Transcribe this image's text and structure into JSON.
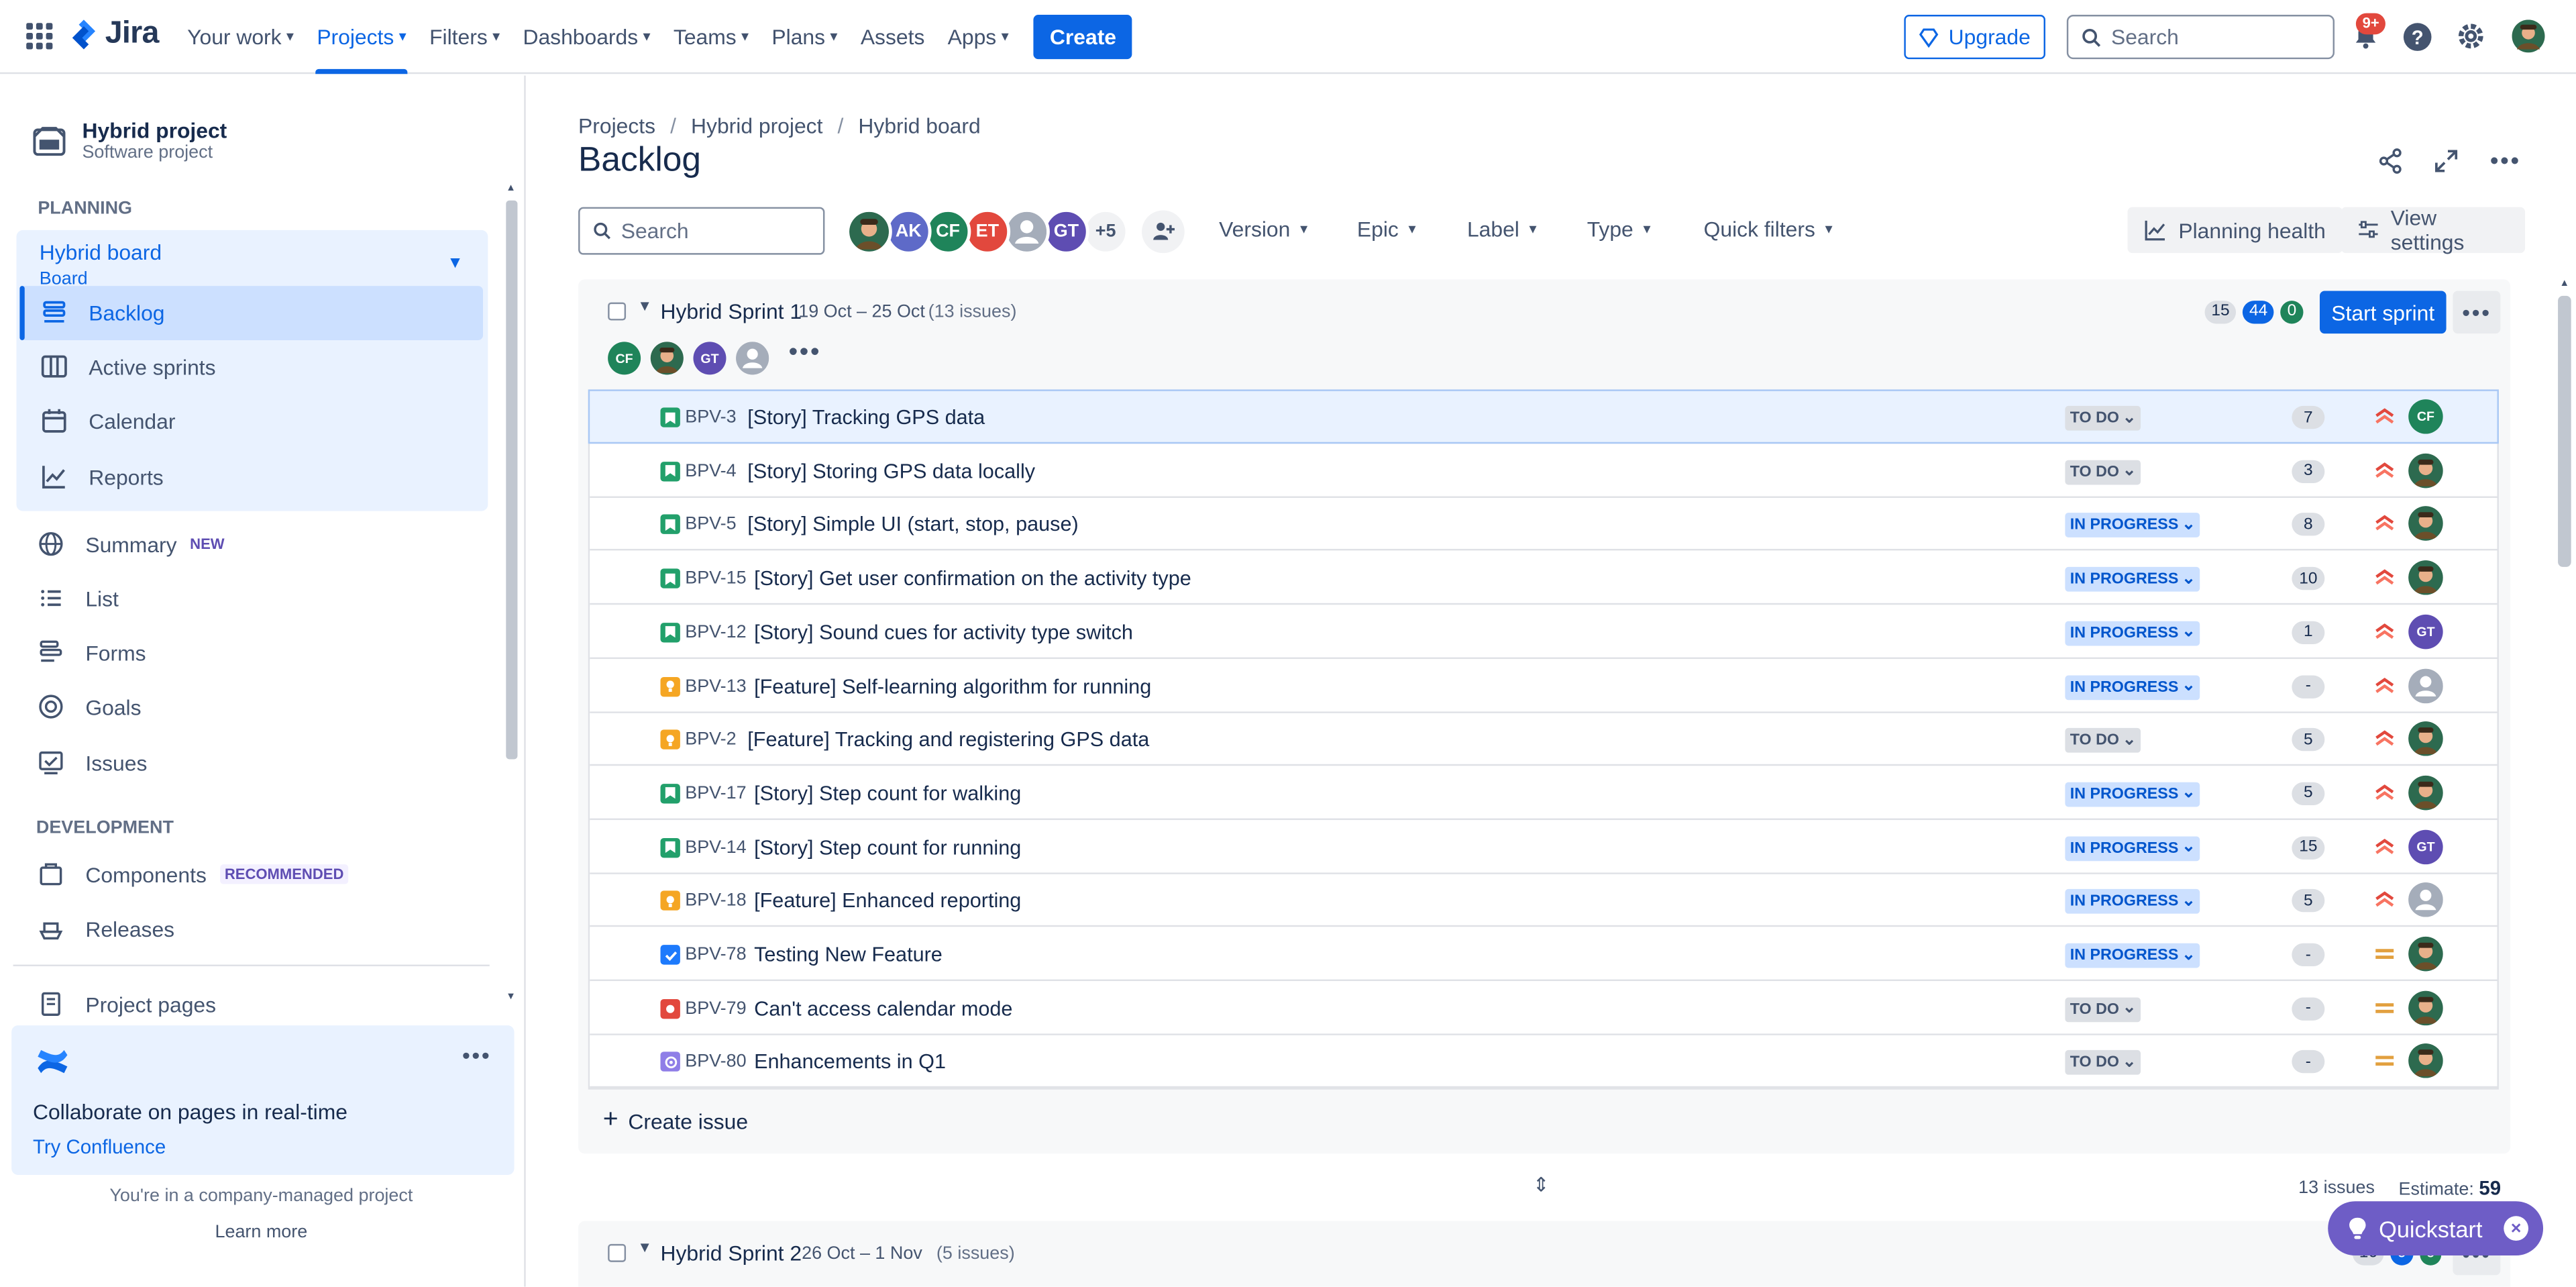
{
  "topnav": {
    "logo": "Jira",
    "links": [
      "Your work",
      "Projects",
      "Filters",
      "Dashboards",
      "Teams",
      "Plans",
      "Assets",
      "Apps"
    ],
    "create": "Create",
    "upgrade": "Upgrade",
    "search_placeholder": "Search",
    "notifications": "9+",
    "help": "?"
  },
  "sidebar": {
    "project_name": "Hybrid project",
    "project_type": "Software project",
    "planning_label": "PLANNING",
    "board_title": "Hybrid board",
    "board_sub": "Board",
    "planning_items": [
      "Backlog",
      "Active sprints",
      "Calendar",
      "Reports"
    ],
    "summary": "Summary",
    "summary_badge": "NEW",
    "list": "List",
    "forms": "Forms",
    "goals": "Goals",
    "issues": "Issues",
    "development_label": "DEVELOPMENT",
    "components": "Components",
    "components_badge": "RECOMMENDED",
    "releases": "Releases",
    "project_pages": "Project pages",
    "promo_title": "Collaborate on pages in real-time",
    "promo_link": "Try Confluence",
    "managed": "You're in a company-managed project",
    "learn_more": "Learn more"
  },
  "main": {
    "breadcrumb": [
      "Projects",
      "Hybrid project",
      "Hybrid board"
    ],
    "title": "Backlog",
    "search_placeholder": "Search",
    "avatars": [
      {
        "initials": "",
        "color": "#2d6a4f"
      },
      {
        "initials": "AK",
        "color": "#5e6ac8"
      },
      {
        "initials": "CF",
        "color": "#1f845a"
      },
      {
        "initials": "ET",
        "color": "#e2483d"
      },
      {
        "initials": "",
        "color": "#a5adba"
      },
      {
        "initials": "GT",
        "color": "#5e4db2"
      }
    ],
    "avatars_more": "+5",
    "filters": [
      "Version",
      "Epic",
      "Label",
      "Type",
      "Quick filters"
    ],
    "planning_health": "Planning health",
    "view_settings": "View settings"
  },
  "sprint1": {
    "title": "Hybrid Sprint 1",
    "dates": "19 Oct – 25 Oct",
    "count": "(13 issues)",
    "stats": [
      "15",
      "44",
      "0"
    ],
    "start": "Start sprint",
    "assignees": [
      {
        "initials": "CF",
        "color": "#1f845a"
      },
      {
        "initials": "",
        "color": "#2d6a4f"
      },
      {
        "initials": "GT",
        "color": "#5e4db2"
      },
      {
        "initials": "",
        "color": "#a5adba"
      }
    ],
    "issues": [
      {
        "type": "story",
        "key": "BPV-3",
        "summary": "[Story] Tracking GPS data",
        "status": "TO DO",
        "estimate": "7",
        "priority": "high",
        "assignee": "CF",
        "avatar_color": "#1f845a"
      },
      {
        "type": "story",
        "key": "BPV-4",
        "summary": "[Story] Storing GPS data locally",
        "status": "TO DO",
        "estimate": "3",
        "priority": "high",
        "assignee": "",
        "avatar_color": "#2d6a4f"
      },
      {
        "type": "story",
        "key": "BPV-5",
        "summary": "[Story] Simple UI (start, stop, pause)",
        "status": "IN PROGRESS",
        "estimate": "8",
        "priority": "high",
        "assignee": "",
        "avatar_color": "#2d6a4f"
      },
      {
        "type": "story",
        "key": "BPV-15",
        "summary": "[Story] Get user confirmation on the activity type",
        "status": "IN PROGRESS",
        "estimate": "10",
        "priority": "high",
        "assignee": "",
        "avatar_color": "#2d6a4f"
      },
      {
        "type": "story",
        "key": "BPV-12",
        "summary": "[Story] Sound cues for activity type switch",
        "status": "IN PROGRESS",
        "estimate": "1",
        "priority": "high",
        "assignee": "GT",
        "avatar_color": "#5e4db2"
      },
      {
        "type": "feature",
        "key": "BPV-13",
        "summary": "[Feature] Self-learning algorithm for running",
        "status": "IN PROGRESS",
        "estimate": "-",
        "priority": "high",
        "assignee": "",
        "avatar_color": "#a5adba"
      },
      {
        "type": "feature",
        "key": "BPV-2",
        "summary": "[Feature] Tracking and registering GPS data",
        "status": "TO DO",
        "estimate": "5",
        "priority": "high",
        "assignee": "",
        "avatar_color": "#2d6a4f"
      },
      {
        "type": "story",
        "key": "BPV-17",
        "summary": "[Story] Step count for walking",
        "status": "IN PROGRESS",
        "estimate": "5",
        "priority": "high",
        "assignee": "",
        "avatar_color": "#2d6a4f"
      },
      {
        "type": "story",
        "key": "BPV-14",
        "summary": "[Story] Step count for running",
        "status": "IN PROGRESS",
        "estimate": "15",
        "priority": "high",
        "assignee": "GT",
        "avatar_color": "#5e4db2"
      },
      {
        "type": "feature",
        "key": "BPV-18",
        "summary": "[Feature] Enhanced reporting",
        "status": "IN PROGRESS",
        "estimate": "5",
        "priority": "high",
        "assignee": "",
        "avatar_color": "#a5adba"
      },
      {
        "type": "task",
        "key": "BPV-78",
        "summary": "Testing New Feature",
        "status": "IN PROGRESS",
        "estimate": "-",
        "priority": "medium",
        "assignee": "",
        "avatar_color": "#2d6a4f"
      },
      {
        "type": "bug",
        "key": "BPV-79",
        "summary": "Can't access calendar mode",
        "status": "TO DO",
        "estimate": "-",
        "priority": "medium",
        "assignee": "",
        "avatar_color": "#2d6a4f"
      },
      {
        "type": "improvement",
        "key": "BPV-80",
        "summary": "Enhancements in Q1",
        "status": "TO DO",
        "estimate": "-",
        "priority": "medium",
        "assignee": "",
        "avatar_color": "#2d6a4f"
      }
    ],
    "create_issue": "Create issue",
    "footer_issues": "13 issues",
    "footer_estimate_label": "Estimate:",
    "footer_estimate": "59"
  },
  "sprint2": {
    "title": "Hybrid Sprint 2",
    "dates": "26 Oct – 1 Nov",
    "count": "(5 issues)",
    "stats": [
      "16",
      "0",
      "0"
    ]
  },
  "quickstart": "Quickstart"
}
